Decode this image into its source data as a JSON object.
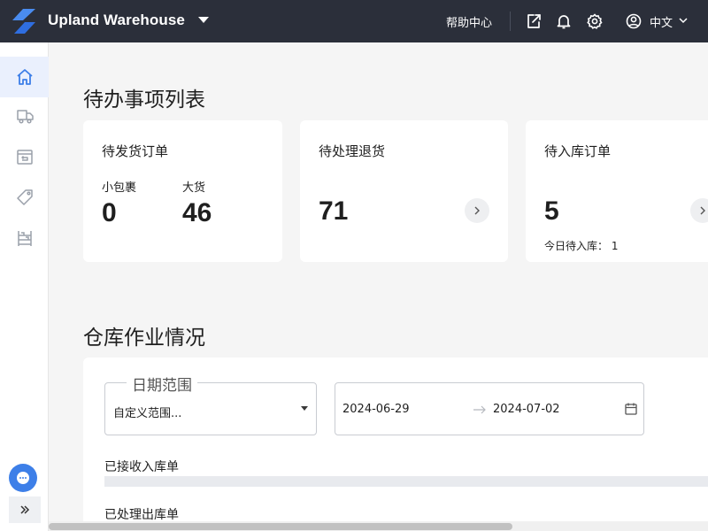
{
  "header": {
    "app_title": "Upland Warehouse",
    "help_label": "帮助中心",
    "language": "中文",
    "icons": [
      "logo-icon",
      "export-icon",
      "bell-icon",
      "gear-icon",
      "user-icon"
    ]
  },
  "sidebar": {
    "items": [
      {
        "name": "home",
        "icon": "home-icon",
        "active": true
      },
      {
        "name": "shipping",
        "icon": "truck-icon",
        "active": false
      },
      {
        "name": "returns",
        "icon": "return-box-icon",
        "active": false
      },
      {
        "name": "products",
        "icon": "tag-icon",
        "active": false
      },
      {
        "name": "warehouse",
        "icon": "shelf-icon",
        "active": false
      }
    ]
  },
  "todo": {
    "title": "待办事项列表",
    "cards": [
      {
        "title": "待发货订单",
        "small_label": "小包裹",
        "small_value": "0",
        "large_label": "大货",
        "large_value": "46"
      },
      {
        "title": "待处理退货",
        "value": "71"
      },
      {
        "title": "待入库订单",
        "value": "5",
        "note": "今日待入库： 1"
      }
    ]
  },
  "ops": {
    "title": "仓库作业情况",
    "range_label": "日期范围",
    "range_value": "自定义范围...",
    "date_start": "2024-06-29",
    "date_end": "2024-07-02",
    "rows": [
      "已接收入库单",
      "已处理出库单"
    ]
  },
  "colors": {
    "header_bg": "#2b2f3a",
    "accent": "#3d7fe8",
    "active_nav_bg": "#eaf0fd"
  }
}
